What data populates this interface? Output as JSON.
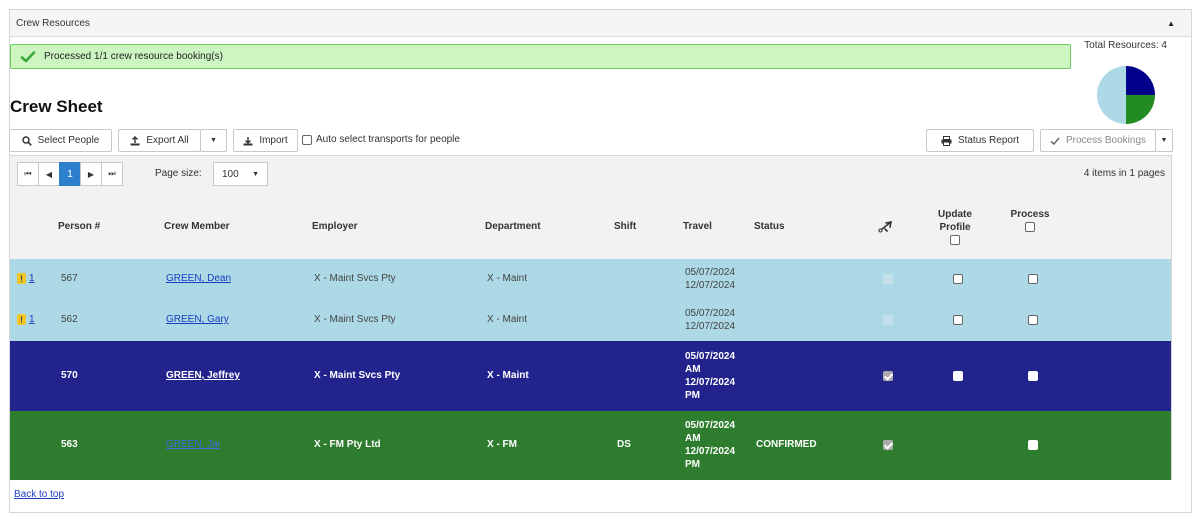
{
  "panel": {
    "title": "Crew Resources",
    "collapse_icon": "chevron-up-icon"
  },
  "alert": {
    "icon": "check-icon",
    "message": "Processed 1/1 crew resource booking(s)"
  },
  "summary": {
    "total_label": "Total Resources: 4",
    "pie": [
      {
        "label": "navy",
        "value": 1,
        "color": "#00008b"
      },
      {
        "label": "green",
        "value": 1,
        "color": "#228b22"
      },
      {
        "label": "light",
        "value": 2,
        "color": "#add8e6"
      }
    ]
  },
  "page_title": "Crew Sheet",
  "toolbar": {
    "select_people": "Select People",
    "export_all": "Export All",
    "import": "Import",
    "auto_select": "Auto select transports for people",
    "status_report": "Status Report",
    "process_bookings": "Process Bookings"
  },
  "pager": {
    "first": "⏮",
    "prev": "◀",
    "current": "1",
    "next": "▶",
    "last": "⏭",
    "page_size_label": "Page size:",
    "page_size": "100",
    "items_info": "4 items in 1 pages"
  },
  "columns": {
    "person": "Person #",
    "crew_member": "Crew Member",
    "employer": "Employer",
    "department": "Department",
    "shift": "Shift",
    "travel": "Travel",
    "status": "Status",
    "transport_icon": "plane-icon",
    "update_profile_1": "Update",
    "update_profile_2": "Profile",
    "process": "Process"
  },
  "rows": [
    {
      "style": "light",
      "warn": "1",
      "person": "567",
      "name": "GREEN, Dean",
      "employer": "X - Maint Svcs Pty",
      "department": "X - Maint",
      "shift": "",
      "travel_1": "05/07/2024",
      "travel_2": "12/07/2024",
      "status": ""
    },
    {
      "style": "light",
      "warn": "1",
      "person": "562",
      "name": "GREEN, Gary",
      "employer": "X - Maint Svcs Pty",
      "department": "X - Maint",
      "shift": "",
      "travel_1": "05/07/2024",
      "travel_2": "12/07/2024",
      "status": ""
    },
    {
      "style": "navy",
      "warn": "",
      "person": "570",
      "name": "GREEN, Jeffrey",
      "employer": "X - Maint Svcs Pty",
      "department": "X - Maint",
      "shift": "",
      "travel_1": "05/07/2024",
      "travel_1b": "AM",
      "travel_2": "12/07/2024",
      "travel_2b": "PM",
      "status": ""
    },
    {
      "style": "green",
      "warn": "",
      "person": "563",
      "name": "GREEN, Jai",
      "employer": "X - FM Pty Ltd",
      "department": "X - FM",
      "shift": "DS",
      "travel_1": "05/07/2024",
      "travel_1b": "AM",
      "travel_2": "12/07/2024",
      "travel_2b": "PM",
      "status": "CONFIRMED"
    }
  ],
  "footer": {
    "back_to_top": "Back to top"
  }
}
